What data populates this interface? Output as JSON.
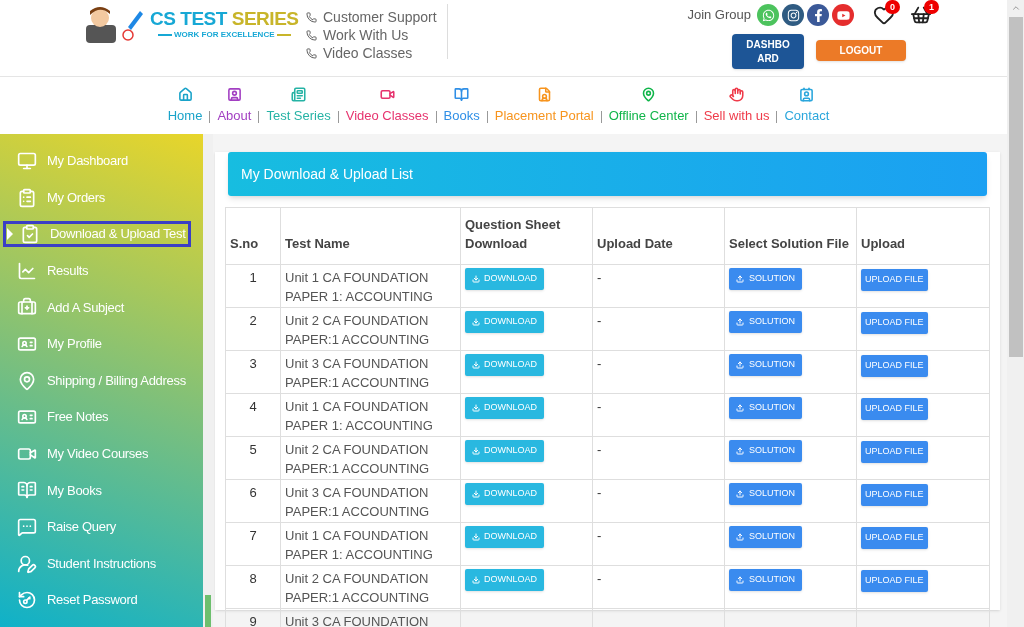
{
  "logo": {
    "title_part1": "CS TEST",
    "title_part2": "SERIES",
    "tagline": "WORK FOR EXCELLENCE"
  },
  "contact_links": [
    "Customer Support",
    "Work With Us",
    "Video Classes"
  ],
  "join_group": {
    "label": "Join Group"
  },
  "wishlist": {
    "count": "0"
  },
  "cart": {
    "count": "1"
  },
  "buttons": {
    "dashboard": "DASHBO ARD",
    "logout": "LOGOUT"
  },
  "nav": [
    {
      "label": "Home",
      "color": "#1aa3c9"
    },
    {
      "label": "About",
      "color": "#a23fc2"
    },
    {
      "label": "Test Series",
      "color": "#26b3a5"
    },
    {
      "label": "Video Classes",
      "color": "#e6336e"
    },
    {
      "label": "Books",
      "color": "#2f8fe6"
    },
    {
      "label": "Placement Portal",
      "color": "#f7941d"
    },
    {
      "label": "Offline Center",
      "color": "#10b54a"
    },
    {
      "label": "Sell with us",
      "color": "#ef3b4a"
    },
    {
      "label": "Contact",
      "color": "#2aa6dc"
    }
  ],
  "sidebar": {
    "items": [
      {
        "label": "My Dashboard",
        "selected": false
      },
      {
        "label": "My Orders",
        "selected": false
      },
      {
        "label": "Download & Upload Test",
        "selected": true
      },
      {
        "label": "Results",
        "selected": false
      },
      {
        "label": "Add A Subject",
        "selected": false
      },
      {
        "label": "My Profile",
        "selected": false
      },
      {
        "label": "Shipping / Billing Address",
        "selected": false
      },
      {
        "label": "Free Notes",
        "selected": false
      },
      {
        "label": "My Video Courses",
        "selected": false
      },
      {
        "label": "My Books",
        "selected": false
      },
      {
        "label": "Raise Query",
        "selected": false
      },
      {
        "label": "Student Instructions",
        "selected": false
      },
      {
        "label": "Reset Password",
        "selected": false
      }
    ]
  },
  "panel": {
    "title": "My Download & Upload List"
  },
  "table": {
    "columns": [
      "S.no",
      "Test Name",
      "Question Sheet Download",
      "Upload Date",
      "Select Solution File",
      "Upload"
    ],
    "rows": [
      {
        "sno": "1",
        "name": [
          "Unit 1 CA FOUNDATION",
          "PAPER 1: ACCOUNTING"
        ],
        "download": "DOWNLOAD",
        "date": "-",
        "solution": "SOLUTION",
        "upload": "UPLOAD FILE"
      },
      {
        "sno": "2",
        "name": [
          "Unit 2 CA FOUNDATION",
          "PAPER:1 ACCOUNTING"
        ],
        "download": "DOWNLOAD",
        "date": "-",
        "solution": "SOLUTION",
        "upload": "UPLOAD FILE"
      },
      {
        "sno": "3",
        "name": [
          "Unit 3 CA FOUNDATION",
          "PAPER:1 ACCOUNTING"
        ],
        "download": "DOWNLOAD",
        "date": "-",
        "solution": "SOLUTION",
        "upload": "UPLOAD FILE"
      },
      {
        "sno": "4",
        "name": [
          "Unit 1 CA FOUNDATION",
          "PAPER 1: ACCOUNTING"
        ],
        "download": "DOWNLOAD",
        "date": "-",
        "solution": "SOLUTION",
        "upload": "UPLOAD FILE"
      },
      {
        "sno": "5",
        "name": [
          "Unit 2 CA FOUNDATION",
          "PAPER:1 ACCOUNTING"
        ],
        "download": "DOWNLOAD",
        "date": "-",
        "solution": "SOLUTION",
        "upload": "UPLOAD FILE"
      },
      {
        "sno": "6",
        "name": [
          "Unit 3 CA FOUNDATION",
          "PAPER:1 ACCOUNTING"
        ],
        "download": "DOWNLOAD",
        "date": "-",
        "solution": "SOLUTION",
        "upload": "UPLOAD FILE"
      },
      {
        "sno": "7",
        "name": [
          "Unit 1 CA FOUNDATION",
          "PAPER 1: ACCOUNTING"
        ],
        "download": "DOWNLOAD",
        "date": "-",
        "solution": "SOLUTION",
        "upload": "UPLOAD FILE"
      },
      {
        "sno": "8",
        "name": [
          "Unit 2 CA FOUNDATION",
          "PAPER:1 ACCOUNTING"
        ],
        "download": "DOWNLOAD",
        "date": "-",
        "solution": "SOLUTION",
        "upload": "UPLOAD FILE"
      },
      {
        "sno": "9",
        "name": [
          "Unit 3 CA FOUNDATION"
        ]
      }
    ]
  }
}
